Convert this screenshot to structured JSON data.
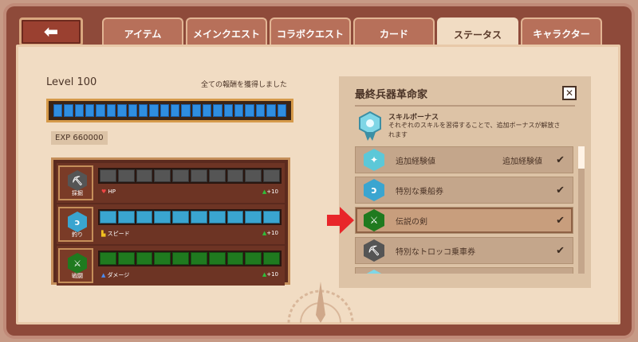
{
  "nav": {
    "back_icon": "back-arrow-icon",
    "tabs": [
      "アイテム",
      "メインクエスト",
      "コラボクエスト",
      "カード",
      "ステータス",
      "キャラクター"
    ],
    "active_tab": "ステータス"
  },
  "profile": {
    "level": "Level 100",
    "rewards_status": "全ての報酬を獲得しました",
    "exp": "EXP 660000",
    "xp_progress": 1.0
  },
  "stats": [
    {
      "name": "採掘",
      "icon": "pickaxe-icon",
      "color": "#555555",
      "stat_label": "HP",
      "stat_icon": "heart-icon",
      "bonus": "+10",
      "fill": 1.0
    },
    {
      "name": "釣り",
      "icon": "fishing-icon",
      "color": "#3aa5d0",
      "stat_label": "スピード",
      "stat_icon": "boot-icon",
      "bonus": "+10",
      "fill": 1.0
    },
    {
      "name": "戦闘",
      "icon": "sword-icon",
      "color": "#1f7a1f",
      "stat_label": "ダメージ",
      "stat_icon": "potion-icon",
      "bonus": "+10",
      "fill": 1.0
    }
  ],
  "panel": {
    "title": "最終兵器革命家",
    "close_label": "✕",
    "bonus_title": "スキルボーナス",
    "bonus_desc": "それぞれのスキルを習得することで、追加ボーナスが解放されます",
    "items": [
      {
        "name": "追加経験値",
        "value": "追加経験値",
        "icon": "xp-hex-icon",
        "color": "#5cc8d8",
        "checked": true
      },
      {
        "name": "特別な乗船券",
        "value": "",
        "icon": "fishing-hex-icon",
        "color": "#3aa5d0",
        "checked": true
      },
      {
        "name": "伝説の剣",
        "value": "",
        "icon": "sword-hex-icon",
        "color": "#1f7a1f",
        "checked": true,
        "highlighted": true
      },
      {
        "name": "特別なトロッコ乗車券",
        "value": "",
        "icon": "pickaxe-hex-icon",
        "color": "#555555",
        "checked": true
      }
    ]
  },
  "colors": {
    "xp_bar": "#2f8ee0",
    "frame": "#8e4a3a",
    "panel_bg": "#f1dcc3",
    "arrow": "#e8262a"
  }
}
